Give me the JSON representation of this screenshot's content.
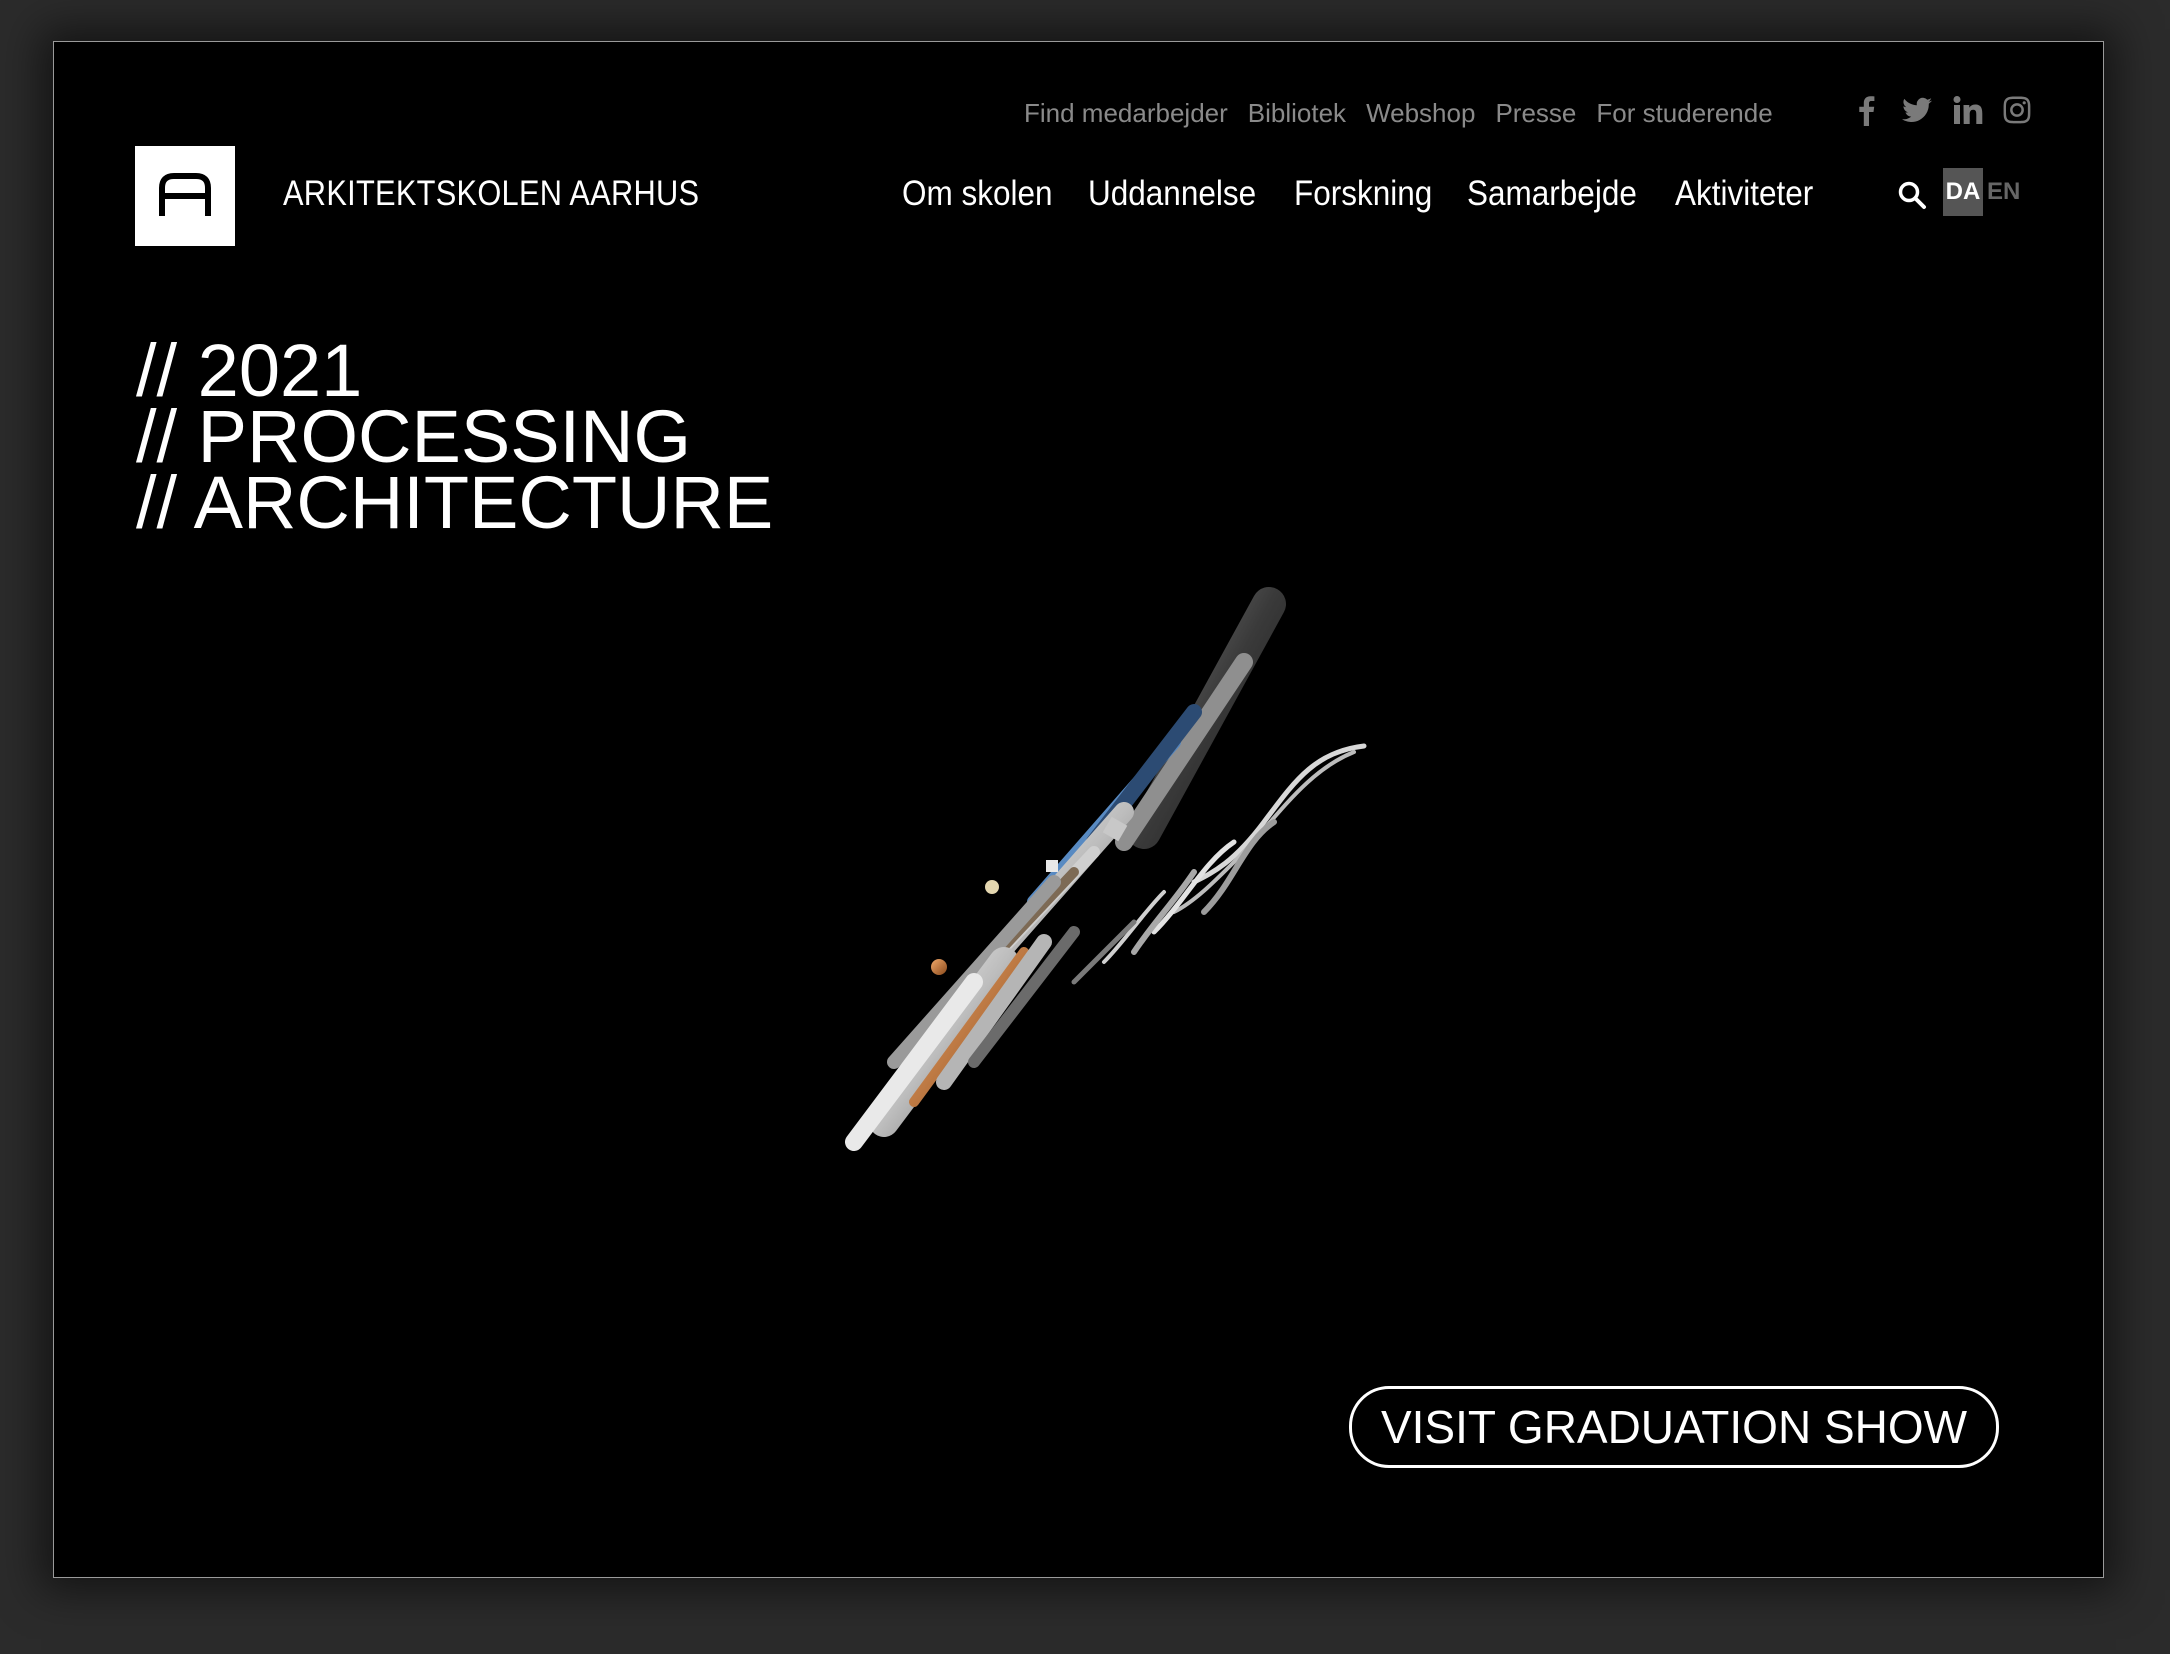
{
  "utility_nav": [
    "Find medarbejder",
    "Bibliotek",
    "Webshop",
    "Presse",
    "For studerende"
  ],
  "social_icons": [
    "facebook-icon",
    "twitter-icon",
    "linkedin-icon",
    "instagram-icon"
  ],
  "brand": {
    "name": "ARKITEKTSKOLEN AARHUS"
  },
  "main_nav": [
    "Om skolen",
    "Uddannelse",
    "Forskning",
    "Samarbejde",
    "Aktiviteter"
  ],
  "search_icon": "search-icon",
  "language": {
    "active": "DA",
    "inactive": "EN"
  },
  "hero": {
    "line1": "// 2021",
    "line2": "// PROCESSING",
    "line3": "// ARCHITECTURE",
    "cta_label": "VISIT GRADUATION SHOW"
  },
  "colors": {
    "background": "#000000",
    "text": "#ffffff",
    "utility_text": "#8a8a8a",
    "lang_active_bg": "#555555",
    "accent_blue": "#3f7fc4",
    "accent_orange": "#c8783c"
  }
}
